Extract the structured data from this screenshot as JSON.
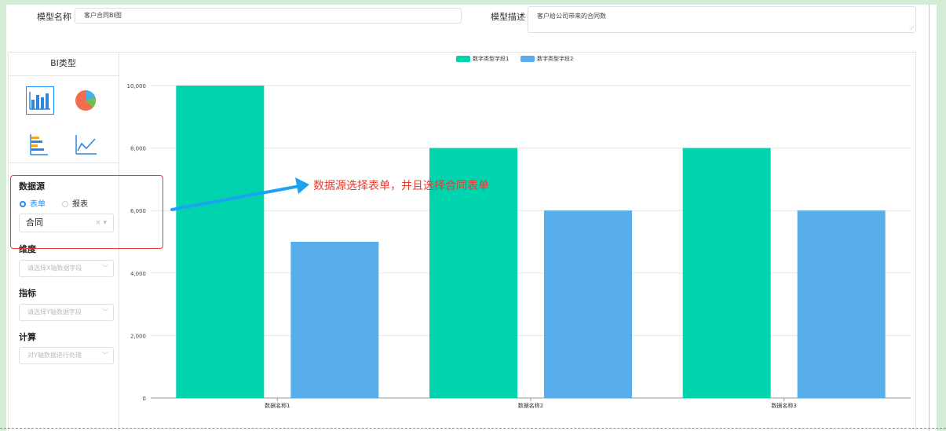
{
  "form": {
    "model_name_label": "模型名称",
    "model_name_value": "客户合同BI图",
    "model_desc_label": "模型描述",
    "model_desc_value": "客户给公司带来的合同数"
  },
  "sidebar": {
    "title": "BI类型",
    "chart_types": [
      "bar-chart-icon",
      "pie-chart-icon",
      "horizontal-bar-chart-icon",
      "line-chart-icon"
    ],
    "datasource": {
      "label": "数据源",
      "options": [
        "表单",
        "报表"
      ],
      "selected": "表单",
      "value": "合同",
      "clear_glyph": "×"
    },
    "dimension": {
      "label": "维度",
      "placeholder": "请选择X轴数据字段"
    },
    "metric": {
      "label": "指标",
      "placeholder": "请选择Y轴数据字段"
    },
    "calc": {
      "label": "计算",
      "placeholder": "对Y轴数据进行处理"
    }
  },
  "annotation": "数据源选择表单，并且选择合同表单",
  "colors": {
    "series1": "#00d4ae",
    "series2": "#57aeeb",
    "accent": "#1890ff",
    "annotation": "#e63b2e",
    "arrow": "#1aa3f0"
  },
  "chart_data": {
    "type": "bar",
    "categories": [
      "数据名称1",
      "数据名称2",
      "数据名称3"
    ],
    "series": [
      {
        "name": "数字类型字段1",
        "values": [
          10000,
          8000,
          8000
        ]
      },
      {
        "name": "数字类型字段2",
        "values": [
          5000,
          6000,
          6000
        ]
      }
    ],
    "ylim": [
      0,
      10000
    ],
    "yticks": [
      "0",
      "2,000",
      "4,000",
      "6,000",
      "8,000",
      "10,000"
    ],
    "grid": true,
    "legend": "top-center",
    "title": "",
    "xlabel": "",
    "ylabel": ""
  }
}
